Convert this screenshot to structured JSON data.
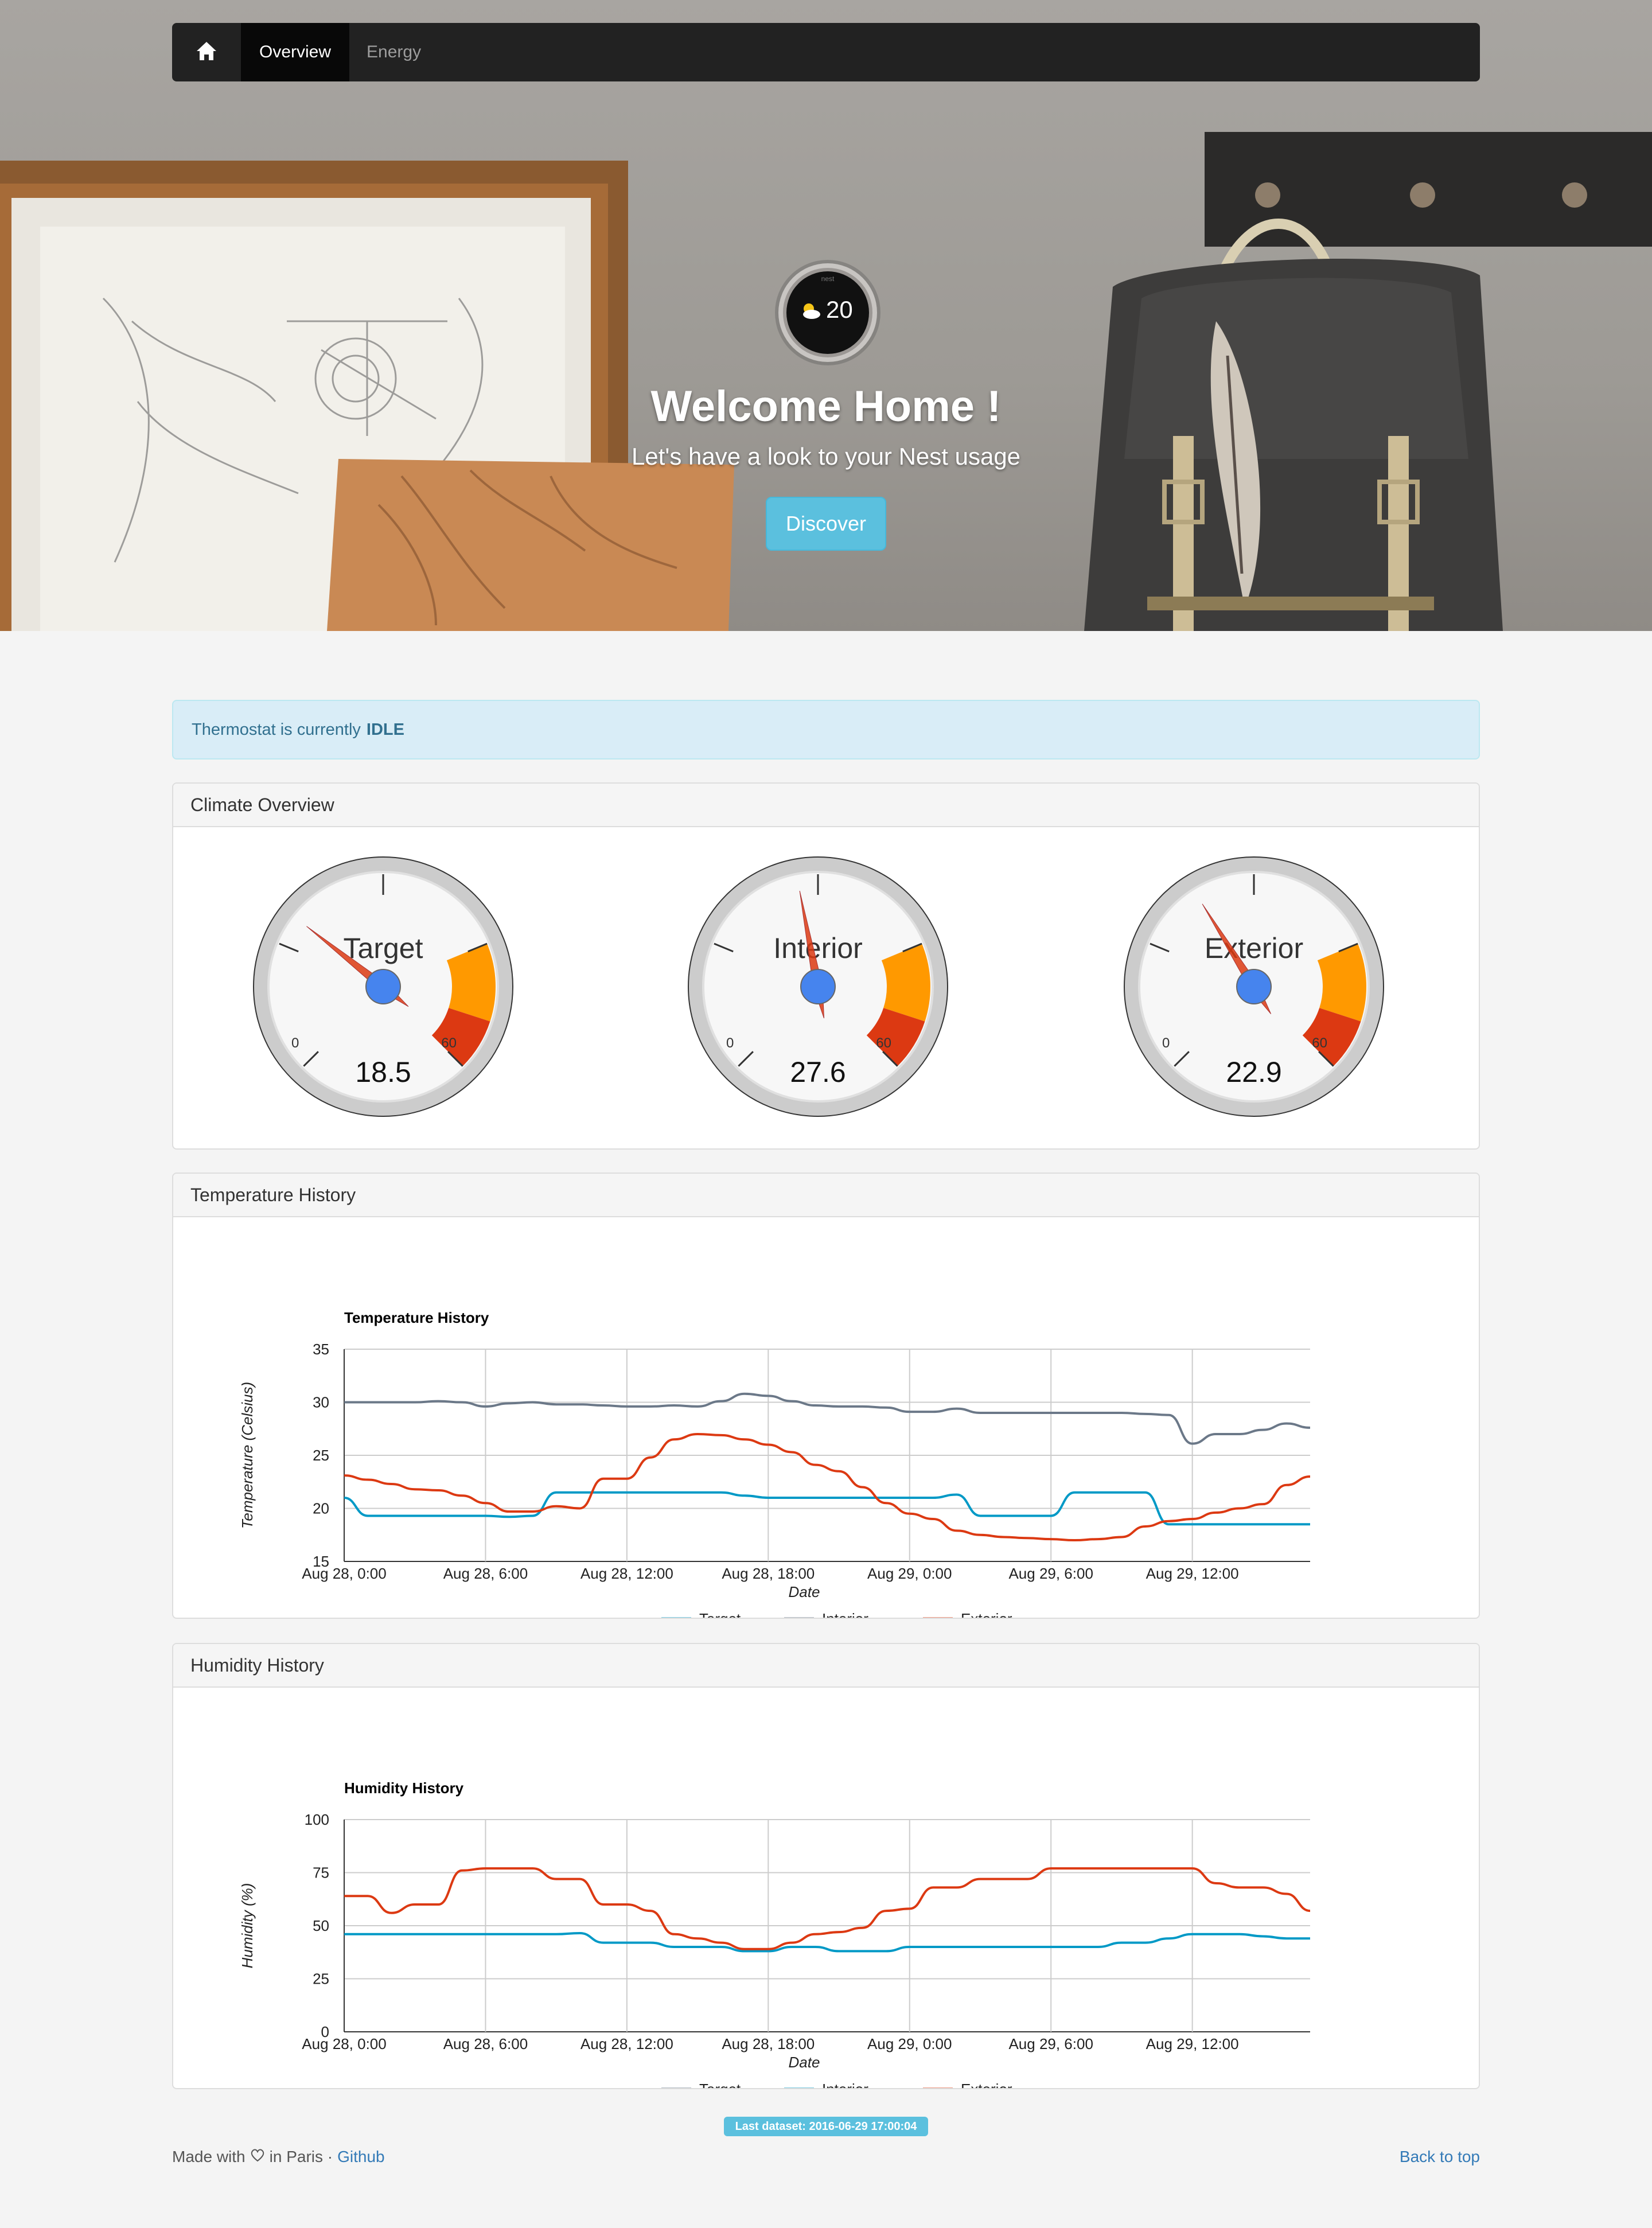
{
  "nav": {
    "home_icon": "home-icon",
    "items": [
      {
        "label": "Overview",
        "active": true
      },
      {
        "label": "Energy",
        "active": false
      }
    ]
  },
  "hero": {
    "thermostat_brand": "nest",
    "thermostat_value": "20",
    "weather_icon": "partly-cloudy-icon",
    "title": "Welcome Home !",
    "subtitle": "Let's have a look to your Nest usage",
    "button_label": "Discover"
  },
  "alert": {
    "prefix": "Thermostat is currently",
    "state": "IDLE"
  },
  "climate": {
    "heading": "Climate Overview",
    "gauges": [
      {
        "label": "Target",
        "value": 18.5,
        "display": "18.5"
      },
      {
        "label": "Interior",
        "value": 27.6,
        "display": "27.6"
      },
      {
        "label": "Exterior",
        "value": 22.9,
        "display": "22.9"
      }
    ],
    "min_label": "0",
    "max_label": "60",
    "colors": {
      "yellow": "#ff9900",
      "red": "#dc3912",
      "hub": "#4684ee",
      "needle": "#dc3912"
    }
  },
  "temperature": {
    "heading": "Temperature History"
  },
  "humidity": {
    "heading": "Humidity History"
  },
  "chart_data": [
    {
      "type": "line",
      "title": "Temperature History",
      "xlabel": "Date",
      "ylabel": "Temperature (Celsius)",
      "ylim": [
        15,
        35
      ],
      "yticks": [
        15,
        20,
        25,
        30,
        35
      ],
      "xlim": [
        0,
        41
      ],
      "xticks": [
        0,
        6,
        12,
        18,
        24,
        30,
        36
      ],
      "xtick_labels": [
        "Aug 28, 0:00",
        "Aug 28, 6:00",
        "Aug 28, 12:00",
        "Aug 28, 18:00",
        "Aug 29, 0:00",
        "Aug 29, 6:00",
        "Aug 29, 12:00"
      ],
      "x": [
        0,
        1,
        2,
        3,
        4,
        5,
        6,
        7,
        8,
        9,
        10,
        11,
        12,
        13,
        14,
        15,
        16,
        17,
        18,
        19,
        20,
        21,
        22,
        23,
        24,
        25,
        26,
        27,
        28,
        29,
        30,
        31,
        32,
        33,
        34,
        35,
        36,
        37,
        38,
        39,
        40,
        41
      ],
      "legend": "bottom",
      "series": [
        {
          "name": "Target",
          "color": "#0099c6",
          "values": [
            21,
            19.3,
            19.3,
            19.3,
            19.3,
            19.3,
            19.3,
            19.2,
            19.3,
            21.5,
            21.5,
            21.5,
            21.5,
            21.5,
            21.5,
            21.5,
            21.5,
            21.2,
            21,
            21,
            21,
            21,
            21,
            21,
            21,
            21,
            21.3,
            19.3,
            19.3,
            19.3,
            19.3,
            21.5,
            21.5,
            21.5,
            21.5,
            18.5,
            18.5,
            18.5,
            18.5,
            18.5,
            18.5,
            18.5
          ]
        },
        {
          "name": "Interior",
          "color": "#6b7888",
          "values": [
            30,
            30,
            30,
            30,
            30.1,
            30,
            29.6,
            29.9,
            30,
            29.8,
            29.8,
            29.7,
            29.6,
            29.6,
            29.7,
            29.6,
            30.1,
            30.8,
            30.6,
            30.1,
            29.7,
            29.6,
            29.6,
            29.5,
            29.1,
            29.1,
            29.4,
            29,
            29,
            29,
            29,
            29,
            29,
            29,
            28.9,
            28.8,
            26.1,
            27,
            27,
            27.4,
            28,
            27.6
          ]
        },
        {
          "name": "Exterior",
          "color": "#dc3912",
          "values": [
            23.1,
            22.7,
            22.3,
            21.8,
            21.7,
            21.2,
            20.5,
            19.7,
            19.7,
            20.2,
            20,
            22.8,
            22.8,
            24.8,
            26.5,
            27,
            26.9,
            26.5,
            26,
            25.3,
            24.1,
            23.5,
            22,
            20.5,
            19.5,
            19,
            17.9,
            17.5,
            17.3,
            17.2,
            17.1,
            17,
            17.1,
            17.3,
            18.3,
            18.8,
            19,
            19.6,
            20,
            20.4,
            22.2,
            23
          ]
        }
      ]
    },
    {
      "type": "line",
      "title": "Humidity History",
      "xlabel": "Date",
      "ylabel": "Humidity (%)",
      "ylim": [
        0,
        100
      ],
      "yticks": [
        0,
        25,
        50,
        75,
        100
      ],
      "xlim": [
        0,
        41
      ],
      "xticks": [
        0,
        6,
        12,
        18,
        24,
        30,
        36
      ],
      "xtick_labels": [
        "Aug 28, 0:00",
        "Aug 28, 6:00",
        "Aug 28, 12:00",
        "Aug 28, 18:00",
        "Aug 29, 0:00",
        "Aug 29, 6:00",
        "Aug 29, 12:00"
      ],
      "x": [
        0,
        1,
        2,
        3,
        4,
        5,
        6,
        7,
        8,
        9,
        10,
        11,
        12,
        13,
        14,
        15,
        16,
        17,
        18,
        19,
        20,
        21,
        22,
        23,
        24,
        25,
        26,
        27,
        28,
        29,
        30,
        31,
        32,
        33,
        34,
        35,
        36,
        37,
        38,
        39,
        40,
        41
      ],
      "legend": "bottom",
      "series": [
        {
          "name": "Target",
          "color": "#6b7888",
          "values": []
        },
        {
          "name": "Interior",
          "color": "#0099c6",
          "values": [
            46,
            46,
            46,
            46,
            46,
            46,
            46,
            46,
            46,
            46,
            46.5,
            42,
            42,
            42,
            40,
            40,
            40,
            38,
            38,
            40,
            40,
            38,
            38,
            38,
            40,
            40,
            40,
            40,
            40,
            40,
            40,
            40,
            40,
            42,
            42,
            44,
            46,
            46,
            46,
            45,
            44,
            44
          ]
        },
        {
          "name": "Exterior",
          "color": "#dc3912",
          "values": [
            64,
            64,
            56,
            60,
            60,
            76,
            77,
            77,
            77,
            72,
            72,
            60,
            60,
            57,
            46,
            44,
            42,
            39,
            39,
            42,
            46,
            47,
            49,
            57,
            58,
            68,
            68,
            72,
            72,
            72,
            77,
            77,
            77,
            77,
            77,
            77,
            77,
            70,
            68,
            68,
            65,
            57
          ]
        }
      ]
    }
  ],
  "footer": {
    "last_dataset": "Last dataset: 2016-06-29 17:00:04",
    "made_with": "Made with",
    "heart_icon": "heart-icon",
    "in_paris": "in Paris ·",
    "github": "Github",
    "back_to_top": "Back to top"
  }
}
